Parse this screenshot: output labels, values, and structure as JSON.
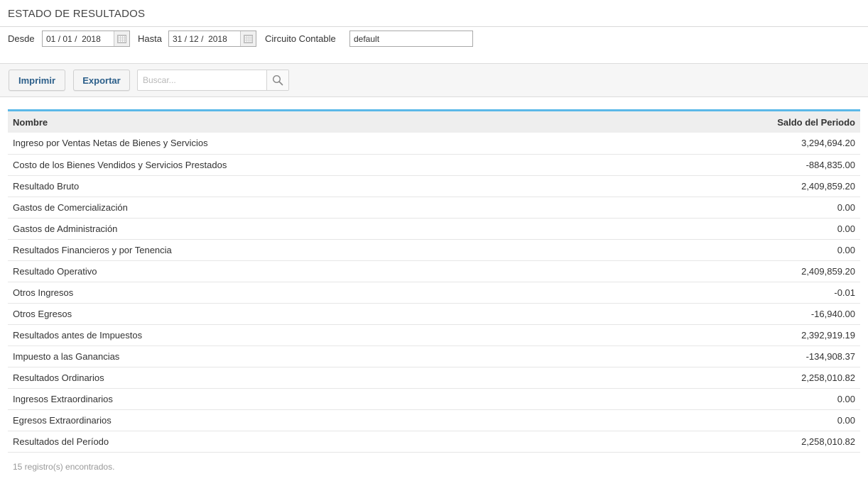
{
  "page": {
    "title": "ESTADO DE RESULTADOS"
  },
  "filters": {
    "desde_label": "Desde",
    "desde": {
      "day": "01",
      "month": "01",
      "year": "2018"
    },
    "hasta_label": "Hasta",
    "hasta": {
      "day": "31",
      "month": "12",
      "year": "2018"
    },
    "circuito_label": "Circuito Contable",
    "circuito_value": "default"
  },
  "toolbar": {
    "print_label": "Imprimir",
    "export_label": "Exportar",
    "search_placeholder": "Buscar..."
  },
  "table": {
    "columns": [
      "Nombre",
      "Saldo del Periodo"
    ],
    "rows": [
      {
        "nombre": "Ingreso por Ventas Netas de Bienes y Servicios",
        "saldo": "3,294,694.20"
      },
      {
        "nombre": "Costo de los Bienes Vendidos y Servicios Prestados",
        "saldo": "-884,835.00"
      },
      {
        "nombre": "Resultado Bruto",
        "saldo": "2,409,859.20"
      },
      {
        "nombre": "Gastos de Comercialización",
        "saldo": "0.00"
      },
      {
        "nombre": "Gastos de Administración",
        "saldo": "0.00"
      },
      {
        "nombre": "Resultados Financieros y por Tenencia",
        "saldo": "0.00"
      },
      {
        "nombre": "Resultado Operativo",
        "saldo": "2,409,859.20"
      },
      {
        "nombre": "Otros Ingresos",
        "saldo": "-0.01"
      },
      {
        "nombre": "Otros Egresos",
        "saldo": "-16,940.00"
      },
      {
        "nombre": "Resultados antes de Impuestos",
        "saldo": "2,392,919.19"
      },
      {
        "nombre": "Impuesto a las Ganancias",
        "saldo": "-134,908.37"
      },
      {
        "nombre": "Resultados Ordinarios",
        "saldo": "2,258,010.82"
      },
      {
        "nombre": "Ingresos Extraordinarios",
        "saldo": "0.00"
      },
      {
        "nombre": "Egresos Extraordinarios",
        "saldo": "0.00"
      },
      {
        "nombre": "Resultados del Período",
        "saldo": "2,258,010.82"
      }
    ]
  },
  "footer": {
    "count_text": "15 registro(s) encontrados."
  },
  "colors": {
    "accent": "#5bb8e8",
    "button_text": "#2c5f8a",
    "header_bg": "#eeeeee"
  },
  "icons": {
    "calendar": "calendar-icon",
    "search": "search-icon"
  }
}
